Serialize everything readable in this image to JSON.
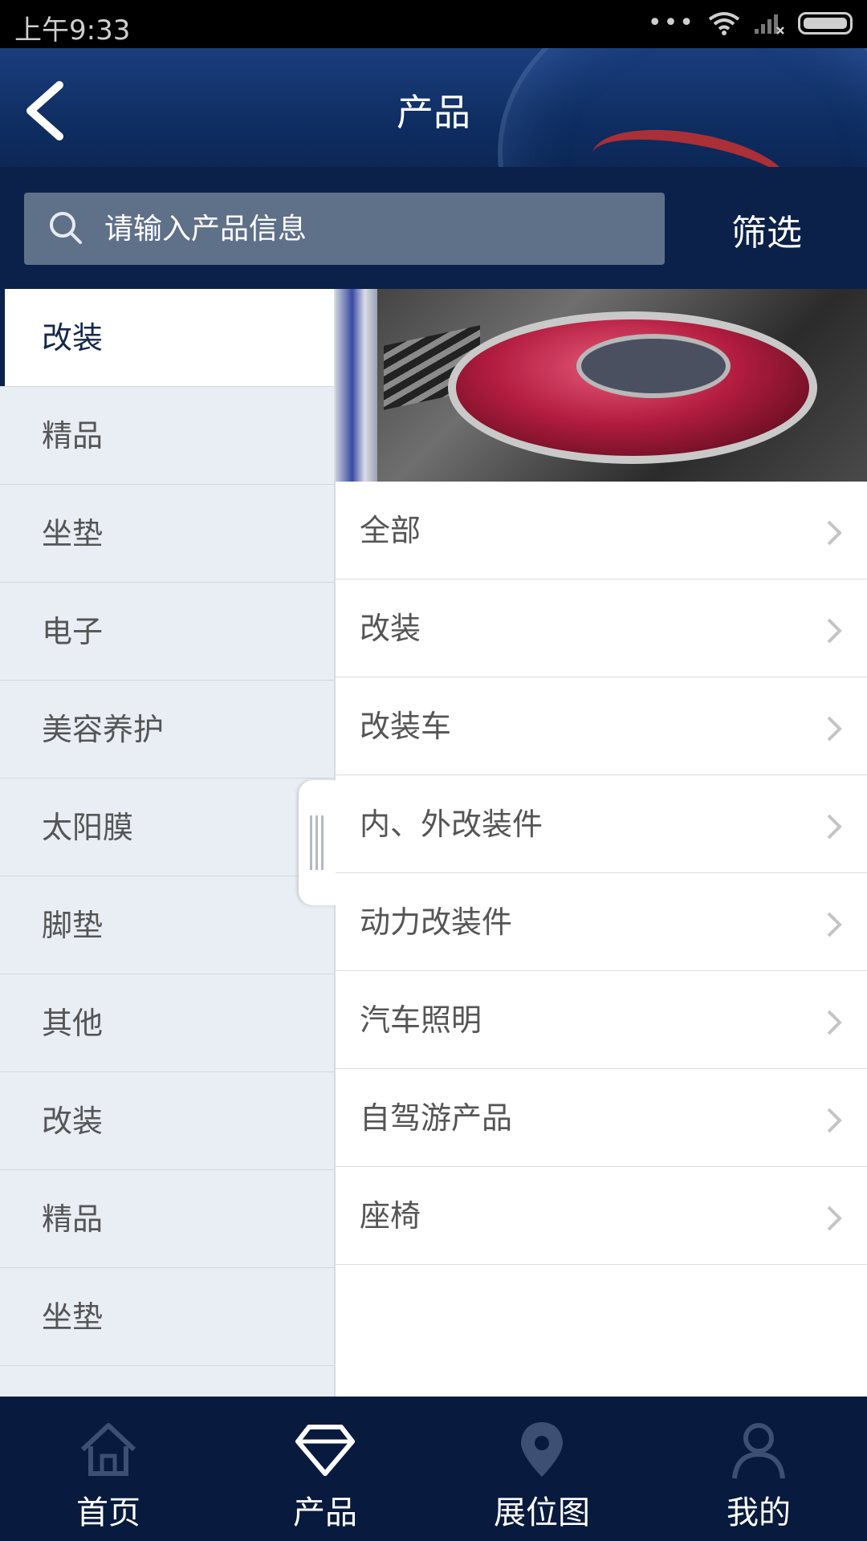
{
  "status_bar": {
    "time": "上午9:33",
    "dots": "•••"
  },
  "header": {
    "title": "产品"
  },
  "search": {
    "placeholder": "请输入产品信息",
    "value": "",
    "filter_label": "筛选"
  },
  "categories": [
    {
      "label": "改装",
      "active": true
    },
    {
      "label": "精品"
    },
    {
      "label": "坐垫"
    },
    {
      "label": "电子"
    },
    {
      "label": "美容养护"
    },
    {
      "label": "太阳膜"
    },
    {
      "label": "脚垫"
    },
    {
      "label": "其他"
    },
    {
      "label": "改装"
    },
    {
      "label": "精品"
    },
    {
      "label": "坐垫"
    }
  ],
  "subcategories": [
    {
      "label": "全部"
    },
    {
      "label": "改装"
    },
    {
      "label": "改装车"
    },
    {
      "label": "内、外改装件"
    },
    {
      "label": "动力改装件"
    },
    {
      "label": "汽车照明"
    },
    {
      "label": "自驾游产品"
    },
    {
      "label": "座椅"
    }
  ],
  "bottom_nav": [
    {
      "label": "首页",
      "icon": "home-icon"
    },
    {
      "label": "产品",
      "icon": "diamond-icon",
      "active": true
    },
    {
      "label": "展位图",
      "icon": "location-pin-icon"
    },
    {
      "label": "我的",
      "icon": "user-icon"
    }
  ],
  "colors": {
    "header_bg": "#0f2e63",
    "search_bar_bg": "#0b2149",
    "search_box_bg": "#5f7089",
    "sidebar_bg": "#e9eef4",
    "nav_bg": "#081a3d"
  }
}
